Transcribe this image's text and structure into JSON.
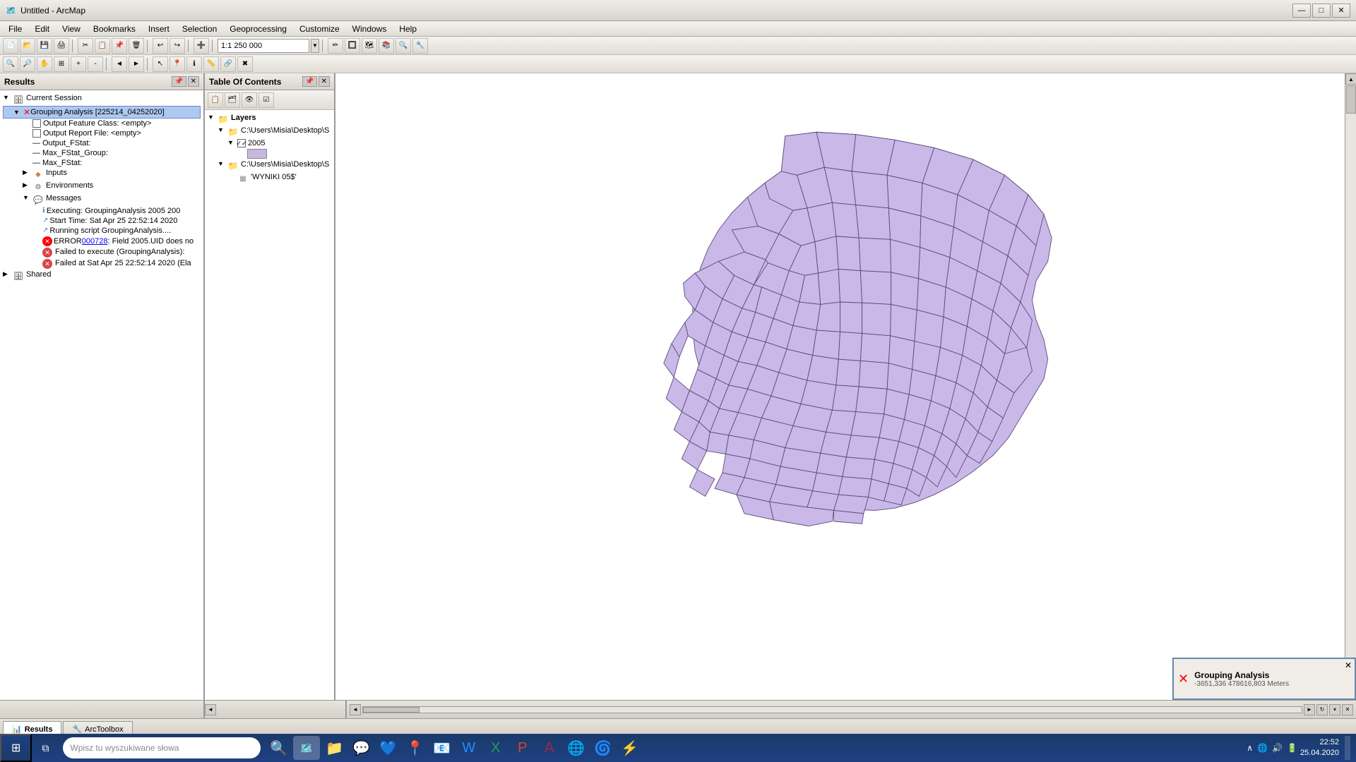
{
  "window": {
    "title": "Untitled - ArcMap"
  },
  "title_bar": {
    "minimize": "—",
    "maximize": "□",
    "close": "✕"
  },
  "menu": {
    "items": [
      "File",
      "Edit",
      "View",
      "Bookmarks",
      "Insert",
      "Selection",
      "Geoprocessing",
      "Customize",
      "Windows",
      "Help"
    ]
  },
  "toolbar1": {
    "scale_value": "1:1 250 000"
  },
  "results_panel": {
    "title": "Results",
    "tree": {
      "session_label": "Current Session",
      "grouping_label": "Grouping Analysis [225214_04252020]",
      "output_feature": "Output Feature Class: <empty>",
      "output_report": "Output Report File: <empty>",
      "output_fstat": "Output_FStat:",
      "max_fstat_group": "Max_FStat_Group:",
      "max_fstat": "Max_FStat:",
      "inputs_label": "Inputs",
      "environments_label": "Environments",
      "messages_label": "Messages",
      "msg1": "Executing: GroupingAnalysis 2005 200",
      "msg2": "Start Time: Sat Apr 25 22:52:14 2020",
      "msg3": "Running script GroupingAnalysis....",
      "error_prefix": "ERROR ",
      "error_code": "000728",
      "error_text": ": Field 2005.UID does no",
      "msg4": "Failed to execute (GroupingAnalysis):",
      "msg5": "Failed at Sat Apr 25 22:52:14 2020 (Ela",
      "shared_label": "Shared"
    }
  },
  "toc_panel": {
    "title": "Table Of Contents",
    "layers_label": "Layers",
    "path1": "C:\\Users\\Misia\\Desktop\\S",
    "layer1": "2005",
    "path2": "C:\\Users\\Misia\\Desktop\\S",
    "layer2": "'WYNIKI 05$'"
  },
  "map": {
    "background": "#ffffff"
  },
  "bottom_tabs": {
    "results_label": "Results",
    "arctoolbox_label": "ArcToolbox"
  },
  "status_bar": {
    "coords": "-3651,336 478616,803 Meters"
  },
  "notification": {
    "title": "Grouping Analysis",
    "coords": "-3651,336 478616,803 Meters"
  },
  "taskbar": {
    "search_placeholder": "Wpisz tu wyszukiwane słowa",
    "clock_time": "22:52",
    "clock_date": "25.04.2020"
  }
}
